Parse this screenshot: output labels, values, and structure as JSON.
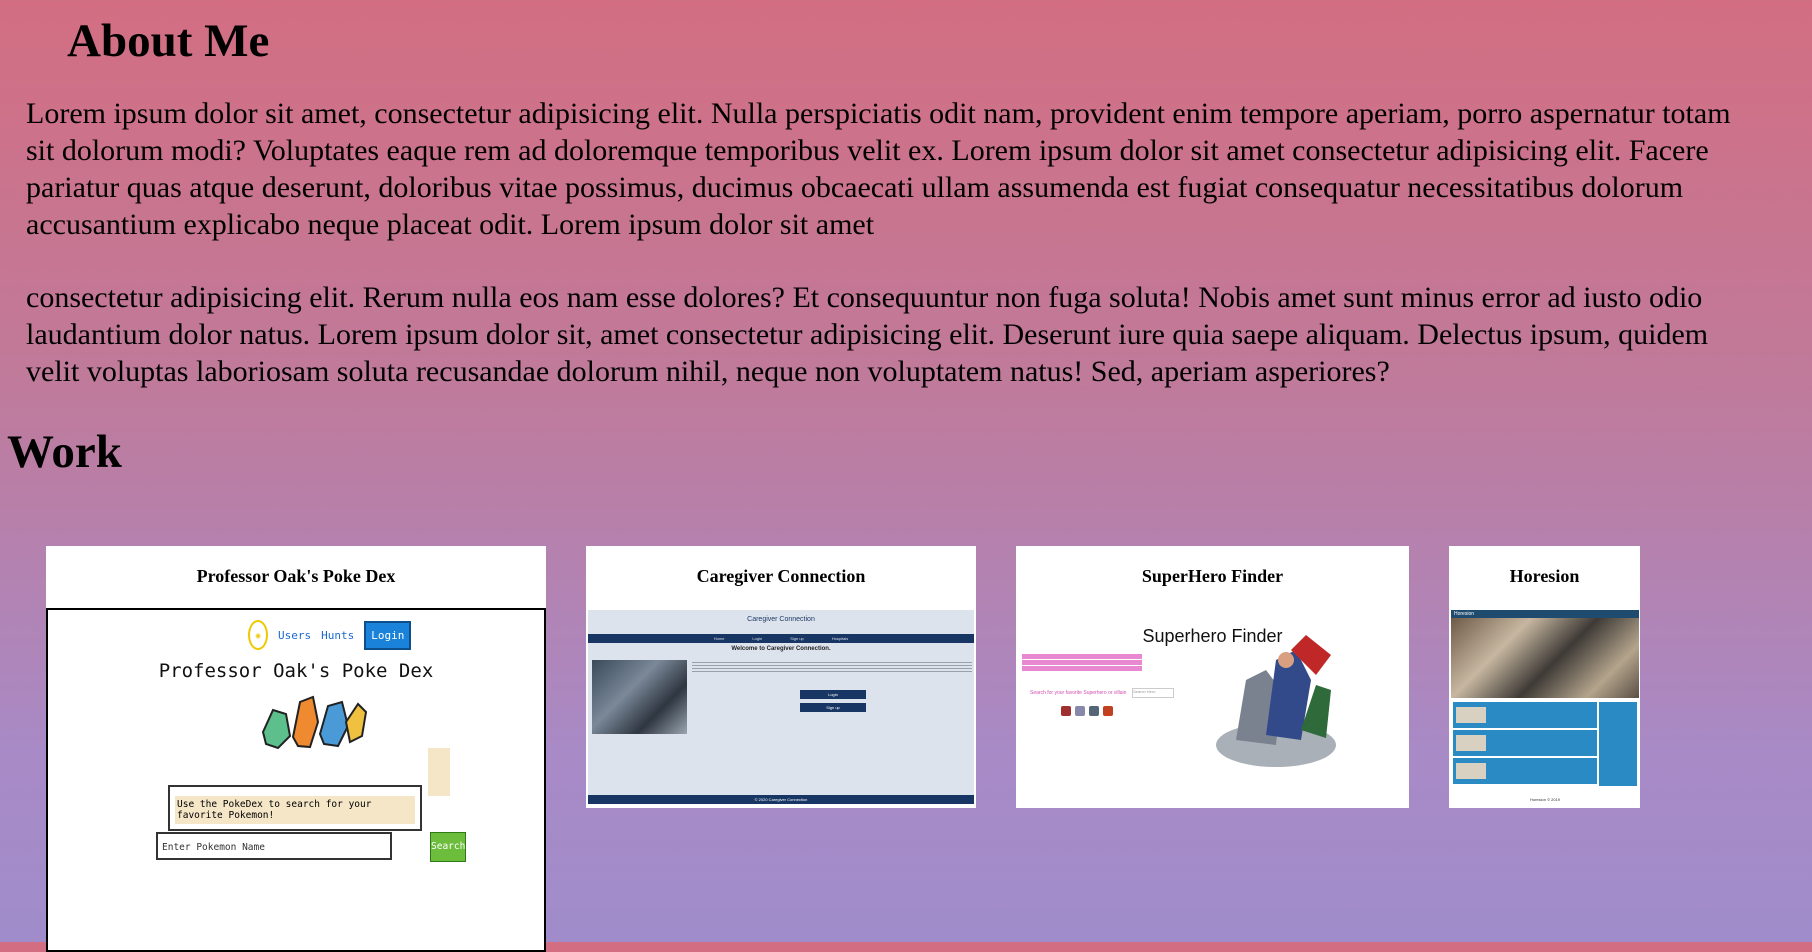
{
  "about": {
    "heading": "About Me",
    "lines": [
      "Lorem ipsum dolor sit amet, consectetur adipisicing elit. Nulla perspiciatis odit nam, provident enim tempore aperiam, porro aspernatur totam",
      "sit dolorum modi? Voluptates eaque rem ad doloremque temporibus velit ex. Lorem ipsum dolor sit amet consectetur adipisicing elit. Facere",
      "pariatur quas atque deserunt, doloribus vitae possimus, ducimus obcaecati ullam assumenda est fugiat consequatur necessitatibus dolorum",
      "accusantium explicabo neque placeat odit. Lorem ipsum dolor sit amet",
      "consectetur adipisicing elit. Rerum nulla eos nam esse dolores? Et consequuntur non fuga soluta! Nobis amet sunt minus error ad iusto odio",
      "laudantium dolor natus. Lorem ipsum dolor sit, amet consectetur adipisicing elit. Deserunt iure quia saepe aliquam. Delectus ipsum, quidem",
      "velit voluptas laboriosam soluta recusandae dolorum nihil, neque non voluptatem natus! Sed, aperiam asperiores?"
    ]
  },
  "work": {
    "heading": "Work",
    "projects": [
      {
        "title": "Professor Oak's Poke Dex",
        "nav": [
          "Users",
          "Hunts",
          "Login"
        ],
        "app_title": "Professor Oak's Poke Dex",
        "bubble": "Use the PokeDex to search for your favorite Pokemon!",
        "input_placeholder": "Enter Pokemon Name",
        "button": "Search"
      },
      {
        "title": "Caregiver Connection",
        "header": "Caregiver Connection",
        "nav": [
          "Home",
          "Login",
          "Sign up",
          "Hospitals"
        ],
        "welcome": "Welcome to Caregiver Connection.",
        "buttons": [
          "Login",
          "Sign up"
        ],
        "footer": "© 2020 Caregiver Connection"
      },
      {
        "title": "SuperHero Finder",
        "app_title": "Superhero Finder",
        "search_label": "Search for your favorite Superhero or villain",
        "input_placeholder": "Search Hero"
      },
      {
        "title": "Horesion",
        "brand": "Horesion",
        "footer": "Horesion © 2019"
      }
    ]
  },
  "colors": {
    "gradient_top": "#d36e82",
    "gradient_bottom": "#a08ccb",
    "pokedex_login": "#1a82d8",
    "pokedex_search": "#6cbd3c",
    "caregiver_navy": "#173663",
    "horesion_blue": "#2a8ac4"
  }
}
